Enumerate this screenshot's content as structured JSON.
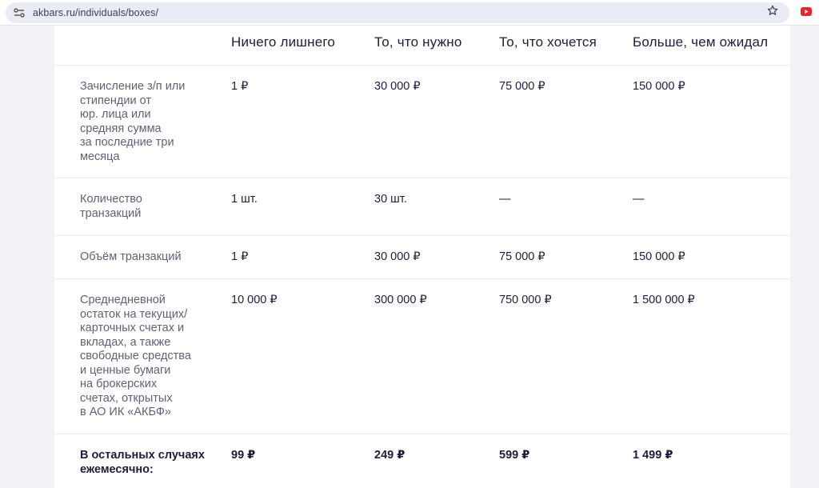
{
  "browser": {
    "url": "akbars.ru/individuals/boxes/",
    "icons": [
      "site-settings-icon",
      "bookmark-star-icon",
      "youtube-extension-icon"
    ]
  },
  "table": {
    "columns": [
      "Ничего лишнего",
      "То, что нужно",
      "То, что хочется",
      "Больше, чем ожидал"
    ],
    "rows": [
      {
        "label": [
          "Зачисление з/п или",
          "стипендии от",
          "юр. лица или",
          "средняя сумма",
          "за последние три",
          "месяца"
        ],
        "values": [
          "1 ₽",
          "30 000 ₽",
          "75 000 ₽",
          "150 000 ₽"
        ]
      },
      {
        "label": [
          "Количество",
          "транзакций"
        ],
        "values": [
          "1 шт.",
          "30 шт.",
          "—",
          "—"
        ]
      },
      {
        "label": [
          "Объём транзакций"
        ],
        "values": [
          "1 ₽",
          "30 000 ₽",
          "75 000 ₽",
          "150 000 ₽"
        ]
      },
      {
        "label": [
          "Среднедневной",
          "остаток на текущих/",
          "карточных счетах и",
          "вкладах, а также",
          "свободные средства",
          "и ценные бумаги",
          "на брокерских",
          "счетах, открытых",
          "в АО ИК «АКБФ»"
        ],
        "values": [
          "10 000 ₽",
          "300 000 ₽",
          "750 000 ₽",
          "1 500 000 ₽"
        ]
      },
      {
        "label": [
          "В остальных случаях",
          "ежемесячно:"
        ],
        "values": [
          "99 ₽",
          "249 ₽",
          "599 ₽",
          "1 499 ₽"
        ]
      }
    ]
  }
}
